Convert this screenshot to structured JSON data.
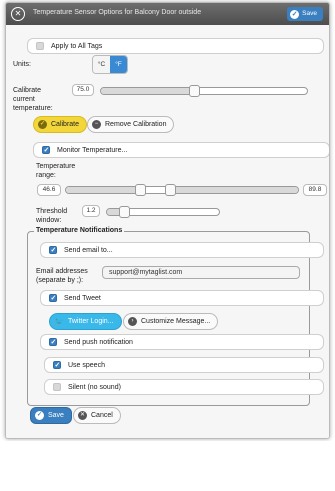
{
  "dialog": {
    "title": "Temperature Sensor Options for Balcony Door outside",
    "save_label": "Save"
  },
  "apply_all": {
    "label": "Apply to All Tags",
    "checked": false
  },
  "units": {
    "label": "Units:",
    "options": [
      "°C",
      "°F"
    ],
    "selected": "°F"
  },
  "calibrate": {
    "label": "Calibrate current temperature:",
    "value": "75.0",
    "slider_fraction": 0.45,
    "calibrate_button": "Calibrate",
    "remove_button": "Remove Calibration"
  },
  "monitor": {
    "label": "Monitor Temperature...",
    "checked": true
  },
  "temperature_range": {
    "label": "Temperature range:",
    "min": "46.6",
    "max": "89.8",
    "low_fraction": 0.32,
    "high_fraction": 0.45
  },
  "threshold": {
    "label": "Threshold window:",
    "value": "1.2",
    "slider_fraction": 0.15
  },
  "notifications": {
    "legend": "Temperature Notifications",
    "send_email": {
      "label": "Send email to...",
      "checked": true
    },
    "email_label": "Email addresses (separate by ;):",
    "email_value": "support@mytaglist.com",
    "send_tweet": {
      "label": "Send Tweet",
      "checked": true
    },
    "twitter_login": "Twitter Login...",
    "customize_message": "Customize Message...",
    "send_push": {
      "label": "Send push notification",
      "checked": true
    },
    "use_speech": {
      "label": "Use speech",
      "checked": true
    },
    "silent": {
      "label": "Silent (no sound)",
      "checked": false
    }
  },
  "footer": {
    "save_label": "Save",
    "cancel_label": "Cancel"
  },
  "colors": {
    "primary": "#3a7fbf",
    "calibrate": "#f2d63a",
    "twitter": "#3bb8ea",
    "titlebar": "#5a5a5a"
  }
}
